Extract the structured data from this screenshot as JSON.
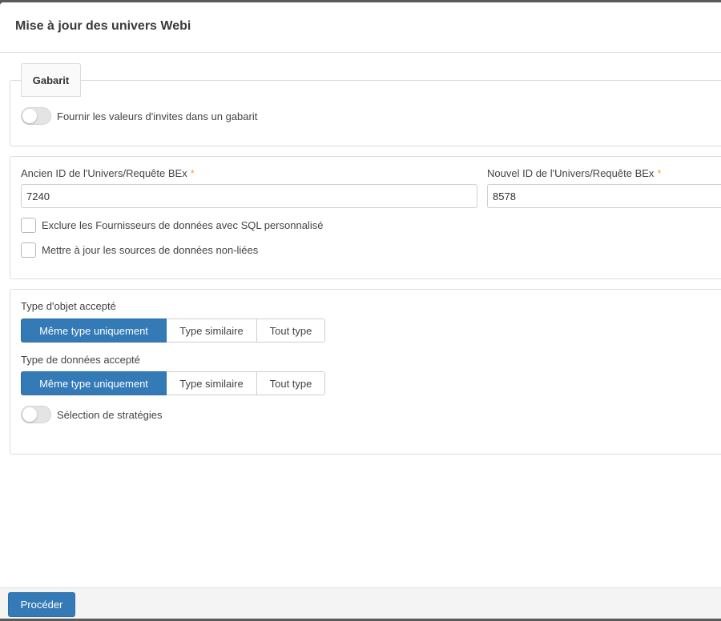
{
  "dialog": {
    "title": "Mise à jour des univers Webi"
  },
  "template": {
    "tab_label": "Gabarit",
    "toggle_label": "Fournir les valeurs d'invites dans un gabarit",
    "toggle_on": false
  },
  "ids": {
    "old_label": "Ancien ID de l'Univers/Requête BEx",
    "old_value": "7240",
    "new_label": "Nouvel ID de l'Univers/Requête BEx",
    "new_value": "8578",
    "required_mark": "*",
    "checkboxes": [
      {
        "label": "Exclure les Fournisseurs de données avec SQL personnalisé",
        "checked": false
      },
      {
        "label": "Mettre à jour les sources de données non-liées",
        "checked": false
      }
    ]
  },
  "types": {
    "object_type_label": "Type d'objet accepté",
    "object_type_options": [
      "Même type uniquement",
      "Type similaire",
      "Tout type"
    ],
    "object_type_selected": "Même type uniquement",
    "data_type_label": "Type de données accepté",
    "data_type_options": [
      "Même type uniquement",
      "Type similaire",
      "Tout type"
    ],
    "data_type_selected": "Même type uniquement",
    "strategy_toggle_label": "Sélection de stratégies",
    "strategy_toggle_on": false
  },
  "footer": {
    "proceed_label": "Procéder"
  },
  "colors": {
    "accent": "#337ab7",
    "required": "#f5a623"
  }
}
